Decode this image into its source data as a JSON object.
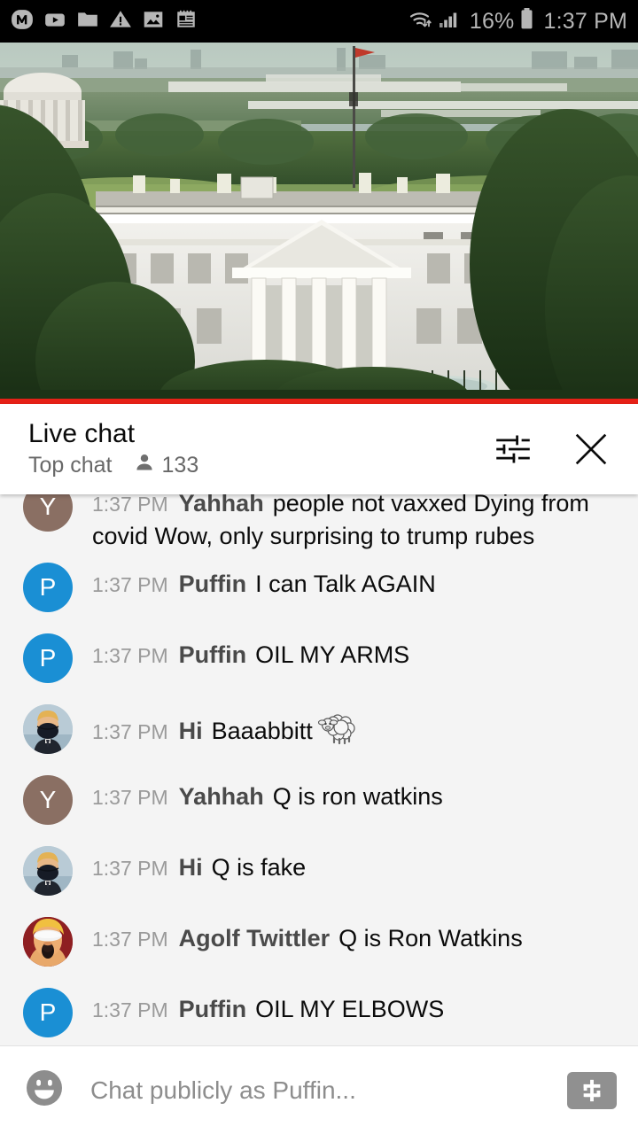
{
  "status_bar": {
    "icons_left": [
      "m-app-icon",
      "youtube-icon",
      "folder-icon",
      "warning-triangle-icon",
      "image-icon",
      "notepad-icon"
    ],
    "wifi_icon": "wifi-transfer-icon",
    "signal_icon": "cellular-signal-icon",
    "battery_percent": "16%",
    "battery_icon": "battery-icon",
    "clock": "1:37 PM"
  },
  "video": {
    "name": "white-house-live-stream",
    "progress_color": "#e62117"
  },
  "chat_header": {
    "title": "Live chat",
    "mode": "Top chat",
    "viewer_count": "133",
    "settings_icon": "tune-sliders-icon",
    "close_icon": "close-icon"
  },
  "messages": [
    {
      "time": "1:37 PM",
      "author": "Yahhah",
      "text": "people not vaxxed Dying from covid Wow, only surprising to trump rubes",
      "avatar_type": "initial",
      "avatar_initial": "Y",
      "avatar_color": "#8a6f63",
      "clipped": true
    },
    {
      "time": "1:37 PM",
      "author": "Puffin",
      "text": "I can Talk AGAIN",
      "avatar_type": "initial",
      "avatar_initial": "P",
      "avatar_color": "#1a8fd4"
    },
    {
      "time": "1:37 PM",
      "author": "Puffin",
      "text": "OIL MY ARMS",
      "avatar_type": "initial",
      "avatar_initial": "P",
      "avatar_color": "#1a8fd4"
    },
    {
      "time": "1:37 PM",
      "author": "Hi",
      "text": "Baaabbitt",
      "emoji": "sheep-emoji",
      "avatar_type": "photo-masked-man",
      "avatar_color": "#b9cbd6"
    },
    {
      "time": "1:37 PM",
      "author": "Yahhah",
      "text": "Q is ron watkins",
      "avatar_type": "initial",
      "avatar_initial": "Y",
      "avatar_color": "#8a6f63"
    },
    {
      "time": "1:37 PM",
      "author": "Hi",
      "text": "Q is fake",
      "avatar_type": "photo-masked-man",
      "avatar_color": "#b9cbd6"
    },
    {
      "time": "1:37 PM",
      "author": "Agolf Twittler",
      "text": "Q is Ron Watkins",
      "avatar_type": "photo-caricature",
      "avatar_color": "#8e1f22"
    },
    {
      "time": "1:37 PM",
      "author": "Puffin",
      "text": "OIL MY ELBOWS",
      "avatar_type": "initial",
      "avatar_initial": "P",
      "avatar_color": "#1a8fd4"
    }
  ],
  "composer": {
    "emoji_icon": "emoji-smiley-icon",
    "placeholder": "Chat publicly as Puffin...",
    "value": "",
    "superchat_icon": "dollar-superchat-icon"
  }
}
